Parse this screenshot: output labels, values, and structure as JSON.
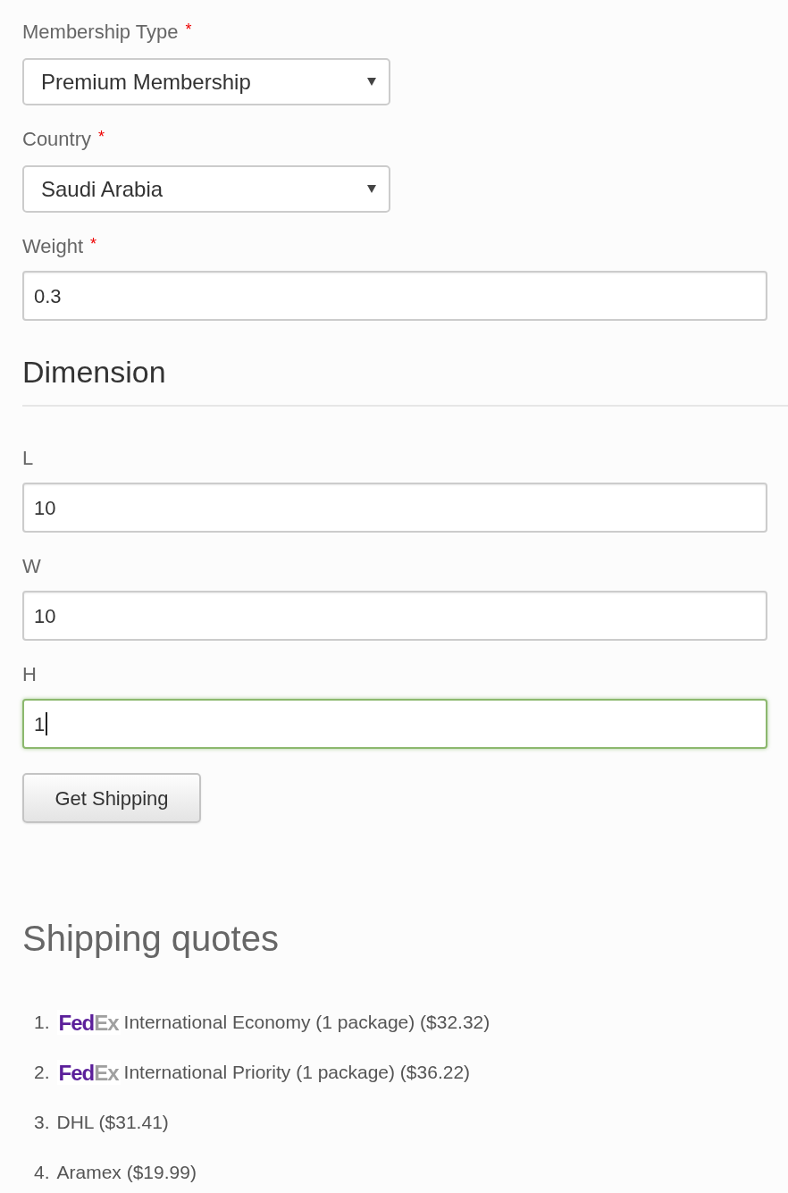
{
  "form": {
    "fields": [
      {
        "kind": "select",
        "label": "Membership Type",
        "marker": "*",
        "value": "Premium Membership"
      },
      {
        "kind": "select",
        "label": "Country",
        "marker": "*",
        "value": "Saudi Arabia"
      },
      {
        "kind": "text",
        "label": "Weight",
        "marker": "*",
        "value": "0.3",
        "focused": false
      }
    ],
    "section": {
      "title": "Dimension",
      "fields": [
        {
          "kind": "text",
          "label": "L",
          "value": "10",
          "focused": false
        },
        {
          "kind": "text",
          "label": "W",
          "value": "10",
          "focused": false
        },
        {
          "kind": "text",
          "label": "H",
          "value": "1",
          "focused": true
        }
      ]
    },
    "button": "Get Shipping"
  },
  "quotes": {
    "title": "Shipping quotes",
    "items": [
      {
        "number": "1.",
        "logo": [
          "Fed",
          "Ex"
        ],
        "text": "International Economy (1 package) ($32.32)"
      },
      {
        "number": "2.",
        "logo": [
          "Fed",
          "Ex"
        ],
        "text": "International Priority (1 package) ($36.22)"
      },
      {
        "number": "3.",
        "text": "DHL ($31.41)"
      },
      {
        "number": "4.",
        "text": "Aramex ($19.99)"
      }
    ]
  }
}
